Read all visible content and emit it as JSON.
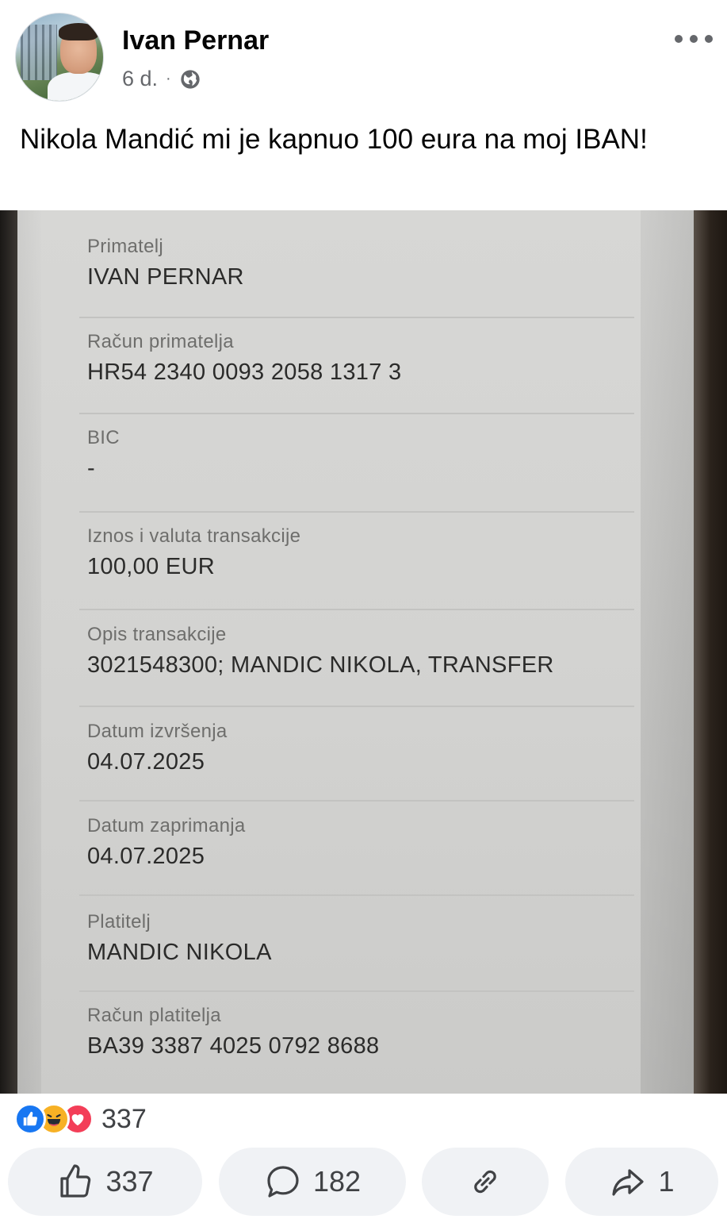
{
  "post": {
    "author": "Ivan Pernar",
    "time": "6 d.",
    "separator": "·",
    "privacy_icon": "globe-icon",
    "text": "Nikola Mandić mi je kapnuo 100 eura na moj IBAN!"
  },
  "receipt": {
    "fields": [
      {
        "label": "Primatelj",
        "value": "IVAN PERNAR"
      },
      {
        "label": "Račun primatelja",
        "value": "HR54 2340 0093 2058 1317 3"
      },
      {
        "label": "BIC",
        "value": "-"
      },
      {
        "label": "Iznos i valuta transakcije",
        "value": "100,00 EUR"
      },
      {
        "label": "Opis transakcije",
        "value": "3021548300; MANDIC NIKOLA, TRANSFER"
      },
      {
        "label": "Datum izvršenja",
        "value": "04.07.2025"
      },
      {
        "label": "Datum zaprimanja",
        "value": "04.07.2025"
      },
      {
        "label": "Platitelj",
        "value": "MANDIC NIKOLA"
      },
      {
        "label": "Račun platitelja",
        "value": "BA39 3387 4025 0792 8688"
      }
    ]
  },
  "reactions": {
    "icons": [
      "like-icon",
      "haha-icon",
      "love-icon"
    ],
    "count": "337"
  },
  "actions": {
    "like_count": "337",
    "comment_count": "182",
    "share_count": "1"
  },
  "colors": {
    "like": "#1877f2",
    "haha": "#f7b125",
    "love": "#f33e58",
    "action_bg": "#f0f2f5"
  }
}
